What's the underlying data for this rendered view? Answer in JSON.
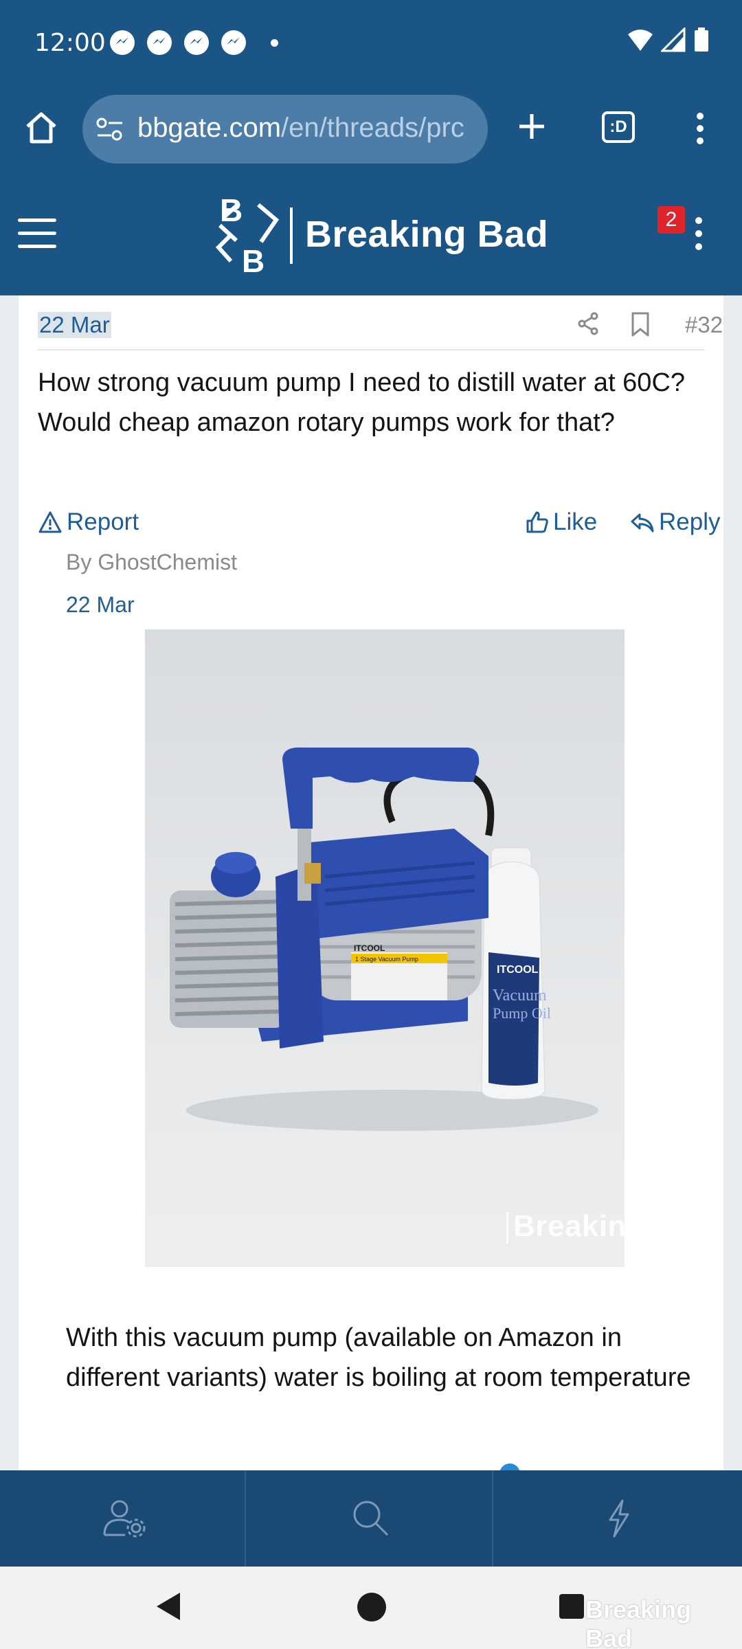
{
  "status_bar": {
    "time": "12:00",
    "notification_icons": [
      "messenger-icon",
      "messenger-icon",
      "messenger-icon",
      "messenger-icon"
    ],
    "system_icons": [
      "wifi-icon",
      "signal-icon",
      "battery-icon"
    ]
  },
  "browser": {
    "url_domain": "bbgate.com",
    "url_path": "/en/threads/prc",
    "tab_count_icon": ":D"
  },
  "site": {
    "brand": "Breaking Bad",
    "logo_letters": "BB",
    "alert_count": "2"
  },
  "post": {
    "date": "22 Mar",
    "number": "#32",
    "text": "How strong vacuum pump I need to distill water at 60C? Would cheap amazon rotary pumps work for that?",
    "report_label": "Report",
    "like_label": "Like",
    "reply_label": "Reply"
  },
  "quote": {
    "by": "By GhostChemist",
    "date": "22 Mar",
    "image_watermark": "Breaking Bad",
    "product_brand": "ITCOOL",
    "product_label": "1 Stage Vacuum Pump",
    "oil_label_1": "Vacuum",
    "oil_label_2": "Pump Oil",
    "text": "With this vacuum pump (available on Amazon in different variants) water is boiling at room temperature"
  },
  "bottom_nav": [
    "account-settings-icon",
    "search-icon",
    "lightning-icon"
  ],
  "system_nav": {
    "watermark": "Breaking Bad"
  },
  "colors": {
    "header_blue": "#1a5586",
    "link_blue": "#1f5d94",
    "badge_red": "#e0242b",
    "pump_blue": "#2f4fb0"
  }
}
